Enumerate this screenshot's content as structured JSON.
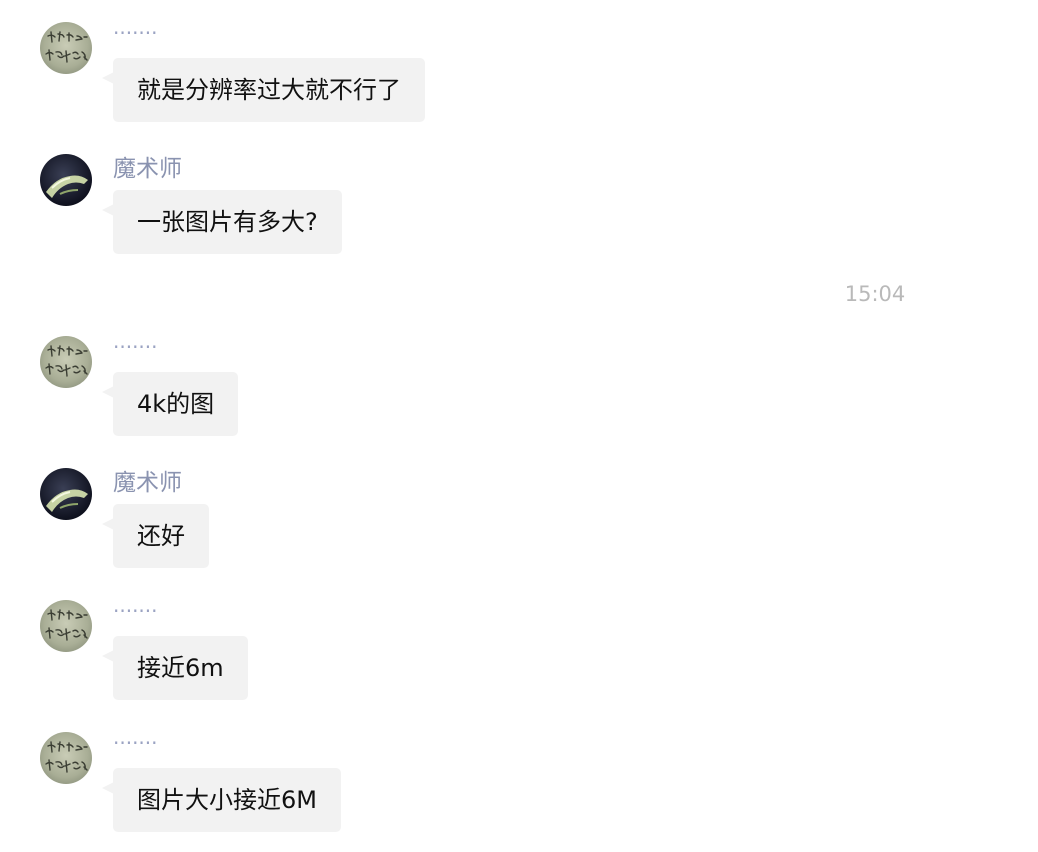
{
  "messages": [
    {
      "sender": "·······",
      "text": "就是分辨率过大就不行了",
      "avatar": "calligraphy-avatar"
    },
    {
      "sender": "魔术师",
      "text": "一张图片有多大?",
      "avatar": "magician-avatar"
    },
    {
      "sender": "·······",
      "text": "4k的图",
      "avatar": "calligraphy-avatar"
    },
    {
      "sender": "魔术师",
      "text": "还好",
      "avatar": "magician-avatar"
    },
    {
      "sender": "·······",
      "text": "接近6m",
      "avatar": "calligraphy-avatar"
    },
    {
      "sender": "·······",
      "text": "图片大小接近6M",
      "avatar": "calligraphy-avatar"
    }
  ],
  "timestamp": "15:04",
  "colors": {
    "bubble": "#f2f2f2",
    "sender_name": "#8a93b0",
    "timestamp": "#b9b9b9",
    "text": "#111111"
  }
}
